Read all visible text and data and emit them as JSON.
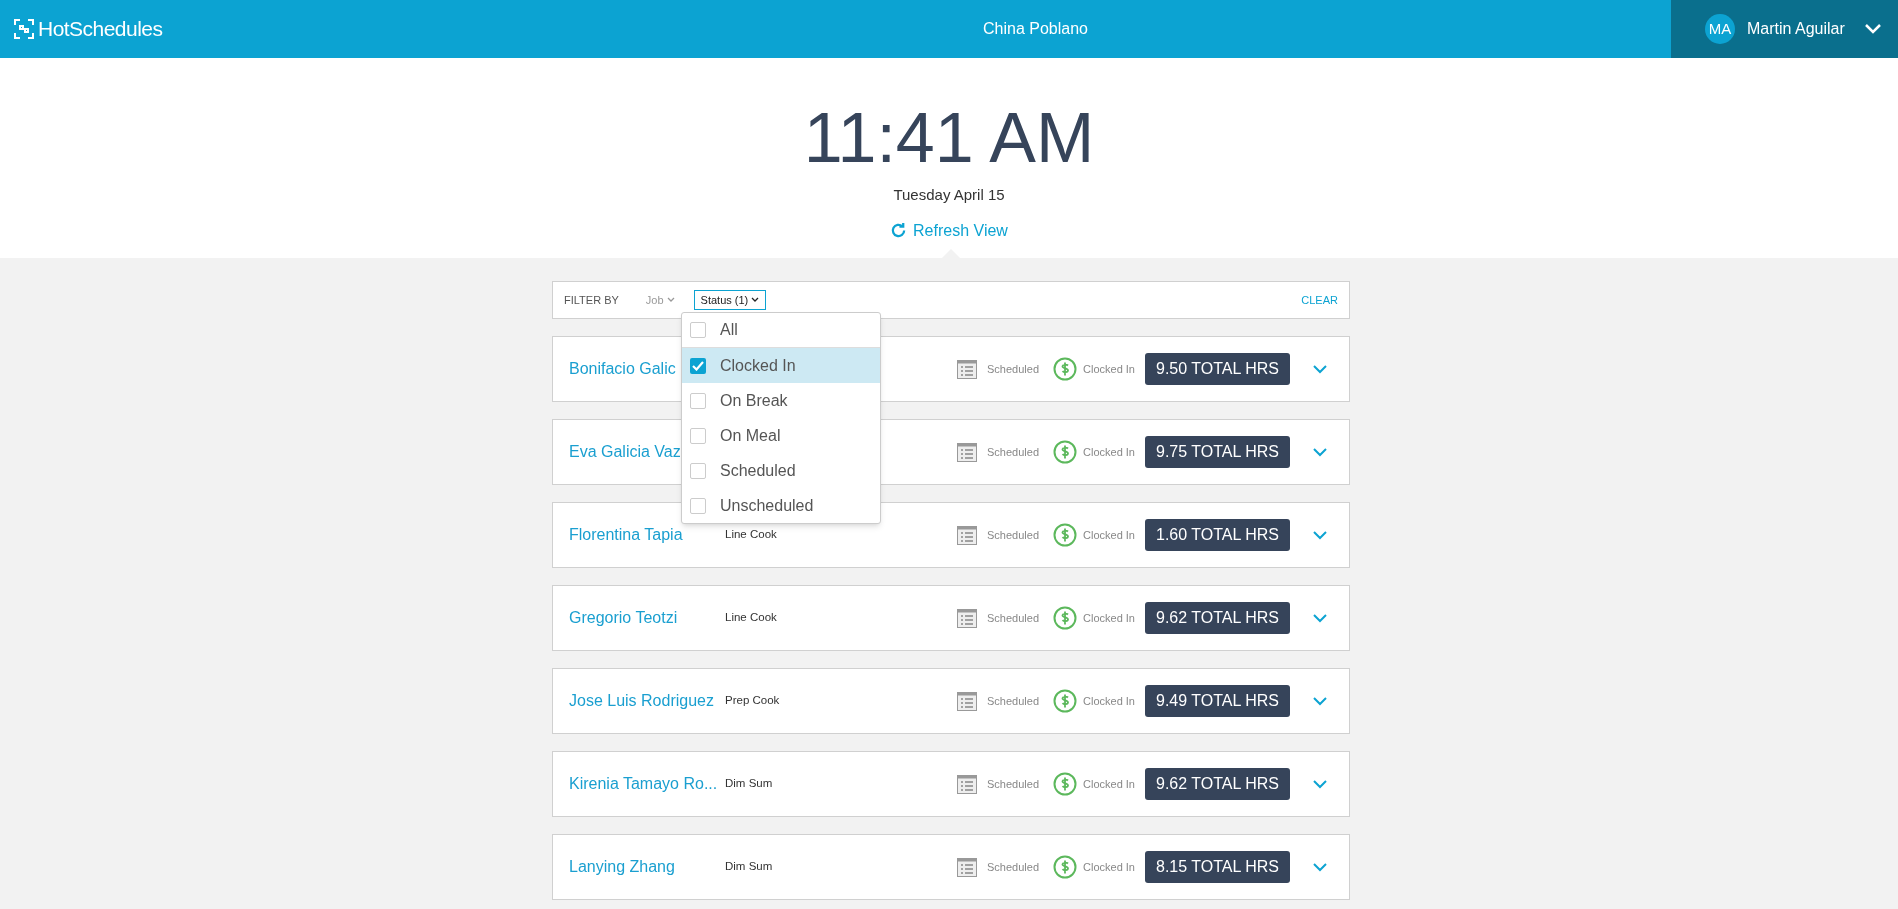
{
  "header": {
    "brand": "HotSchedules",
    "location": "China Poblano",
    "user": {
      "initials": "MA",
      "name": "Martin Aguilar"
    }
  },
  "clock": {
    "time": "11:41 AM",
    "date": "Tuesday April 15",
    "refresh": "Refresh View"
  },
  "filter": {
    "label": "FILTER BY",
    "filters": [
      {
        "label": "Job",
        "selected": false
      },
      {
        "label": "Status (1)",
        "selected": true
      }
    ],
    "clear": "CLEAR"
  },
  "status_menu": [
    {
      "label": "All",
      "checked": false
    },
    {
      "label": "Clocked In",
      "checked": true
    },
    {
      "label": "On Break",
      "checked": false
    },
    {
      "label": "On Meal",
      "checked": false
    },
    {
      "label": "Scheduled",
      "checked": false
    },
    {
      "label": "Unscheduled",
      "checked": false
    }
  ],
  "employees": [
    {
      "name": "Bonifacio Galic",
      "scheduled": "Scheduled",
      "status": "Clocked In",
      "hours": "9.50 TOTAL HRS"
    },
    {
      "name": "Eva Galicia Vaz",
      "scheduled": "Scheduled",
      "status": "Clocked In",
      "hours": "9.75 TOTAL HRS"
    },
    {
      "name": "Florentina Tapia",
      "job": "Line Cook",
      "scheduled": "Scheduled",
      "status": "Clocked In",
      "hours": "1.60 TOTAL HRS"
    },
    {
      "name": "Gregorio Teotzi",
      "job": "Line Cook",
      "scheduled": "Scheduled",
      "status": "Clocked In",
      "hours": "9.62 TOTAL HRS"
    },
    {
      "name": "Jose Luis Rodriguez",
      "job": "Prep Cook",
      "scheduled": "Scheduled",
      "status": "Clocked In",
      "hours": "9.49 TOTAL HRS"
    },
    {
      "name": "Kirenia Tamayo Ro...",
      "job": "Dim Sum",
      "scheduled": "Scheduled",
      "status": "Clocked In",
      "hours": "9.62 TOTAL HRS"
    },
    {
      "name": "Lanying Zhang",
      "job": "Dim Sum",
      "scheduled": "Scheduled",
      "status": "Clocked In",
      "hours": "8.15 TOTAL HRS"
    }
  ]
}
